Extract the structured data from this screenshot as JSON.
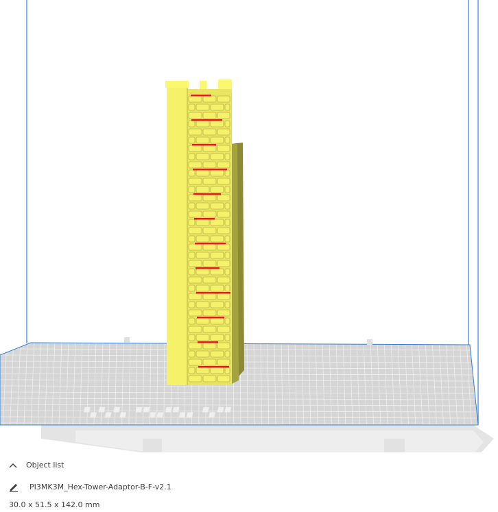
{
  "viewport": {
    "build_volume_color": "#2f7fd6",
    "plate_color": "#d7d7d7",
    "grid_color": "#ffffff",
    "model_color": "#f5f26a",
    "model_shadow_color": "#8c8a36",
    "overhang_color": "#e11c1c"
  },
  "object_panel": {
    "header_label": "Object list",
    "object_name": "PI3MK3M_Hex-Tower-Adaptor-B-F-v2.1",
    "dimensions": "30.0 x 51.5 x 142.0 mm"
  },
  "icons": {
    "collapse": "chevron-up-icon",
    "edit": "pencil-icon"
  }
}
